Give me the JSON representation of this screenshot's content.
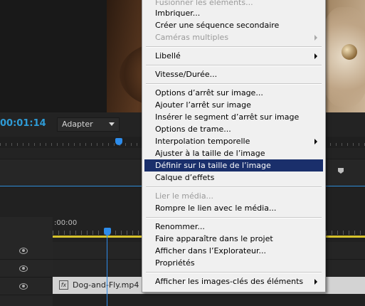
{
  "monitor": {
    "timecode": "00:01:14",
    "fit_value": "Adapter"
  },
  "timeline": {
    "ruler_timecode": ":00:00",
    "clip_name": "Dog-and-Fly.mp4",
    "clip_badge": "fx",
    "colors": {
      "playhead": "#2d8ceb",
      "work_area": "#d7c32c",
      "timecode": "#2e9bd6"
    }
  },
  "menu": {
    "items": [
      {
        "label": "Fusionner les éléments...",
        "disabled": true
      },
      {
        "label": "Imbriquer..."
      },
      {
        "label": "Créer une séquence secondaire"
      },
      {
        "label": "Caméras multiples",
        "disabled": true,
        "submenu": true
      },
      {
        "label": "Libellé",
        "submenu": true
      },
      {
        "label": "Vitesse/Durée..."
      },
      {
        "label": "Options d’arrêt sur image..."
      },
      {
        "label": "Ajouter l’arrêt sur image"
      },
      {
        "label": "Insérer le segment d’arrêt sur image"
      },
      {
        "label": "Options de trame..."
      },
      {
        "label": "Interpolation temporelle",
        "submenu": true
      },
      {
        "label": "Ajuster à la taille de l’image"
      },
      {
        "label": "Définir sur la taille de l’image",
        "selected": true
      },
      {
        "label": "Calque d’effets"
      },
      {
        "label": "Lier le média...",
        "disabled": true
      },
      {
        "label": "Rompre le lien avec le média..."
      },
      {
        "label": "Renommer..."
      },
      {
        "label": "Faire apparaître dans le projet"
      },
      {
        "label": "Afficher dans l’Explorateur..."
      },
      {
        "label": "Propriétés"
      },
      {
        "label": "Afficher les images-clés des éléments",
        "submenu": true
      }
    ]
  }
}
